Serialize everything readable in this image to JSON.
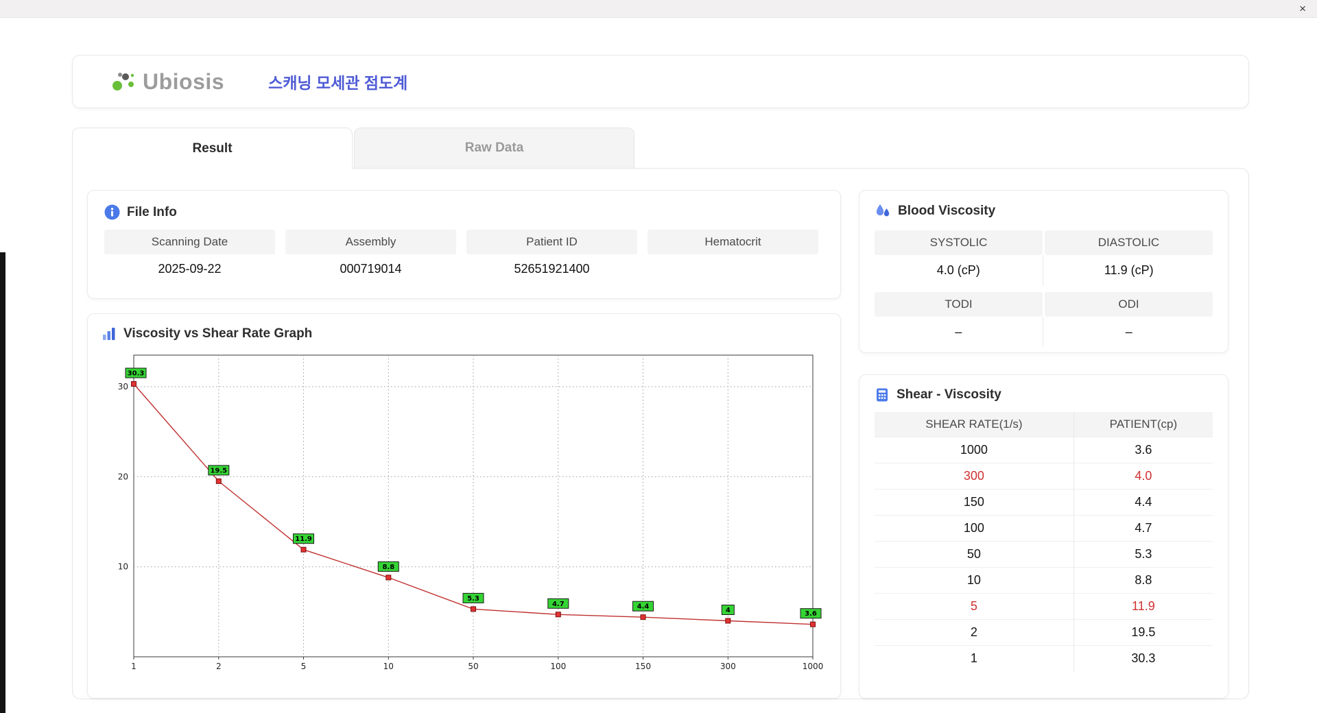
{
  "window": {
    "close": "×"
  },
  "header": {
    "brand": "Ubiosis",
    "app_title": "스캐닝 모세관 점도계"
  },
  "tabs": [
    {
      "label": "Result",
      "active": true
    },
    {
      "label": "Raw Data",
      "active": false
    }
  ],
  "file_info": {
    "title": "File Info",
    "fields": [
      {
        "label": "Scanning Date",
        "value": "2025-09-22"
      },
      {
        "label": "Assembly",
        "value": "000719014"
      },
      {
        "label": "Patient ID",
        "value": "52651921400"
      },
      {
        "label": "Hematocrit",
        "value": ""
      }
    ]
  },
  "blood_viscosity": {
    "title": "Blood Viscosity",
    "cells": [
      {
        "label": "SYSTOLIC",
        "value": "4.0 (cP)"
      },
      {
        "label": "DIASTOLIC",
        "value": "11.9 (cP)"
      },
      {
        "label": "TODI",
        "value": "–"
      },
      {
        "label": "ODI",
        "value": "–"
      }
    ]
  },
  "graph_card": {
    "title": "Viscosity vs Shear Rate Graph"
  },
  "chart_data": {
    "type": "line",
    "title": "Viscosity vs Shear Rate Graph",
    "x_categories": [
      "1",
      "2",
      "5",
      "10",
      "50",
      "100",
      "150",
      "300",
      "1000"
    ],
    "values": [
      30.3,
      19.5,
      11.9,
      8.8,
      5.3,
      4.7,
      4.4,
      4.0,
      3.6
    ],
    "point_labels": [
      "30.3",
      "19.5",
      "11.9",
      "8.8",
      "5.3",
      "4.7",
      "4.4",
      "4",
      "3.6"
    ],
    "xlabel": "",
    "ylabel": "",
    "yticks": [
      10,
      20,
      30
    ],
    "ylim": [
      0,
      33.5
    ],
    "x_scale": "categorical",
    "grid": "dotted",
    "legend": "none",
    "line_color": "#c03030",
    "marker_color": "#e23232",
    "marker_stroke": "#7a1010",
    "label_bg": "#35d435"
  },
  "shear_table": {
    "title": "Shear - Viscosity",
    "columns": [
      "SHEAR RATE(1/s)",
      "PATIENT(cp)"
    ],
    "rows": [
      {
        "shear": "1000",
        "patient": "3.6",
        "highlight": false
      },
      {
        "shear": "300",
        "patient": "4.0",
        "highlight": true
      },
      {
        "shear": "150",
        "patient": "4.4",
        "highlight": false
      },
      {
        "shear": "100",
        "patient": "4.7",
        "highlight": false
      },
      {
        "shear": "50",
        "patient": "5.3",
        "highlight": false
      },
      {
        "shear": "10",
        "patient": "8.8",
        "highlight": false
      },
      {
        "shear": "5",
        "patient": "11.9",
        "highlight": true
      },
      {
        "shear": "2",
        "patient": "19.5",
        "highlight": false
      },
      {
        "shear": "1",
        "patient": "30.3",
        "highlight": false
      }
    ]
  },
  "colors": {
    "accent_blue": "#4f5bd5",
    "icon_blue": "#4a79e8",
    "highlight_red": "#d03030",
    "chart_green": "#35d435",
    "line_red": "#c03030"
  }
}
